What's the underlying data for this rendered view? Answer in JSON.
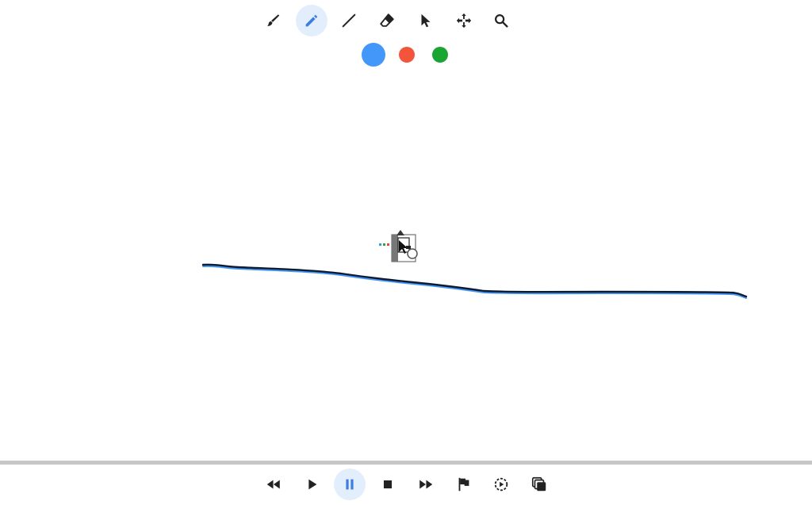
{
  "toolbar": {
    "tools": [
      {
        "name": "brush",
        "icon": "brush-icon",
        "active": false
      },
      {
        "name": "pencil",
        "icon": "pencil-icon",
        "active": true
      },
      {
        "name": "line",
        "icon": "line-icon",
        "active": false
      },
      {
        "name": "eraser",
        "icon": "eraser-icon",
        "active": false
      },
      {
        "name": "select",
        "icon": "cursor-icon",
        "active": false
      },
      {
        "name": "move",
        "icon": "move-icon",
        "active": false
      },
      {
        "name": "zoom",
        "icon": "search-icon",
        "active": false
      }
    ]
  },
  "colors": {
    "options": [
      {
        "name": "blue",
        "hex": "#4397f8",
        "selected": true
      },
      {
        "name": "red",
        "hex": "#f2553b",
        "selected": false
      },
      {
        "name": "green",
        "hex": "#18a532",
        "selected": false
      }
    ]
  },
  "canvas": {
    "stroke_color": "#0d1b30",
    "stroke_highlight": "#4397f8",
    "cursor_icon": "drawing-cursor-icon"
  },
  "playback": {
    "controls": [
      {
        "name": "rewind",
        "icon": "rewind-icon",
        "active": false
      },
      {
        "name": "play",
        "icon": "play-icon",
        "active": false
      },
      {
        "name": "pause",
        "icon": "pause-icon",
        "active": true
      },
      {
        "name": "stop",
        "icon": "stop-icon",
        "active": false
      },
      {
        "name": "fast-forward",
        "icon": "fast-forward-icon",
        "active": false
      },
      {
        "name": "flag",
        "icon": "flag-icon",
        "active": false
      },
      {
        "name": "replay",
        "icon": "replay-icon",
        "active": false
      },
      {
        "name": "layers",
        "icon": "layers-icon",
        "active": false
      }
    ]
  }
}
